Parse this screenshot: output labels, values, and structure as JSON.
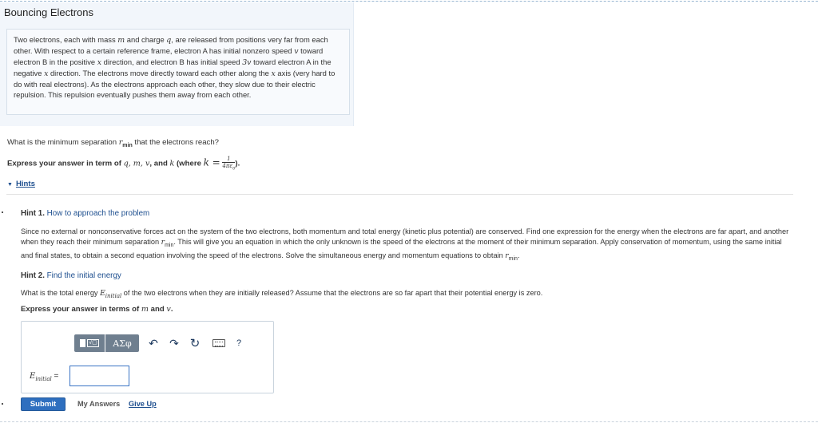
{
  "title": "Bouncing Electrons",
  "problem": {
    "text_1": "Two electrons, each with mass ",
    "m": "m",
    "text_2": " and charge ",
    "q": "q",
    "text_3": ", are released from positions very far from each other. With respect to a certain reference frame, electron A has initial nonzero speed ",
    "v": "v",
    "text_4": " toward electron B in the positive ",
    "x": "x",
    "text_5": " direction, and electron B has initial speed ",
    "three_v": "3v",
    "text_6": " toward electron A in the negative ",
    "text_7": " direction. The electrons move directly toward each other along the ",
    "text_8": " axis (very hard to do with real electrons). As the electrons approach each other, they slow due to their electric repulsion. This repulsion eventually pushes them away from each other."
  },
  "question": {
    "text": "What is the minimum separation ",
    "rmin": "r",
    "rmin_sub": "min",
    "text_end": " that the electrons reach?",
    "instr_1": "Express your answer in term of ",
    "vars": "q, m, v",
    "instr_2": ", and ",
    "k": "k",
    "instr_3": " (where ",
    "k_eq": "k =",
    "frac_num": "1",
    "frac_den": "4πε",
    "frac_den_sub": "0",
    "instr_4": ")."
  },
  "hints": {
    "toggle_label": "Hints",
    "hint1": {
      "number": "Hint 1.",
      "title": "How to approach the problem",
      "body_1": "Since no external or nonconservative forces act on the system of the two electrons, both momentum and total energy (kinetic plus potential) are conserved. Find one expression for the energy when the electrons are far apart, and another when they reach their minimum separation ",
      "body_2": ". This will give you an equation in which the only unknown is the speed of the electrons at the moment of their minimum separation. Apply conservation of momentum, using the same initial and final states, to obtain a second equation involving the speed of the electrons. Solve the simultaneous energy and momentum equations to obtain ",
      "body_3": "."
    },
    "hint2": {
      "number": "Hint 2.",
      "title": "Find the initial energy",
      "body_1": "What is the total energy ",
      "E": "E",
      "E_sub": "initial",
      "body_2": " of the two electrons when they are initially released? Assume that the electrons are so far apart that their potential energy is zero.",
      "instr_1": "Express your answer in terms of ",
      "m": "m",
      "instr_2": " and ",
      "v": "v",
      "instr_3": "."
    }
  },
  "answer": {
    "templates_label": "√▢",
    "symbols_label": "ΑΣφ",
    "undo_glyph": "↶",
    "redo_glyph": "↷",
    "reset_glyph": "↻",
    "help_label": "?",
    "label_E": "E",
    "label_sub": "initial",
    "label_eq": " =",
    "input_value": ""
  },
  "actions": {
    "submit": "Submit",
    "my_answers": "My Answers",
    "give_up": "Give Up"
  }
}
